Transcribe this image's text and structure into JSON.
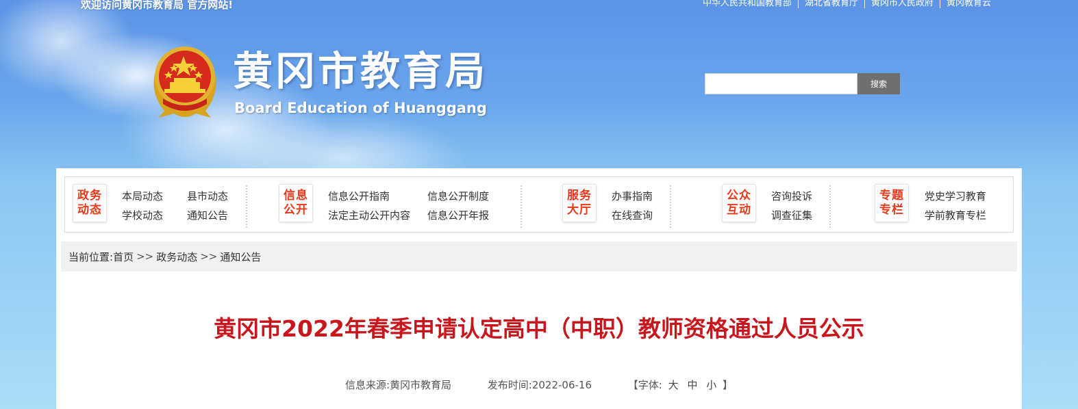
{
  "header": {
    "welcome": "欢迎访问黄冈市教育局 官方网站!",
    "top_links": [
      "中华人民共和国教育部",
      "湖北省教育厅",
      "黄冈市人民政府",
      "黄冈教育云"
    ],
    "site_title": "黄冈市教育局",
    "site_subtitle": "Board Education of Huanggang",
    "search_placeholder": "",
    "search_button": "搜索"
  },
  "nav": {
    "groups": [
      {
        "badge": [
          "政务",
          "动态"
        ],
        "links": [
          "本局动态",
          "县市动态",
          "学校动态",
          "通知公告"
        ]
      },
      {
        "badge": [
          "信息",
          "公开"
        ],
        "links": [
          "信息公开指南",
          "信息公开制度",
          "法定主动公开内容",
          "信息公开年报"
        ]
      },
      {
        "badge": [
          "服务",
          "大厅"
        ],
        "links": [
          "办事指南",
          "在线查询"
        ]
      },
      {
        "badge": [
          "公众",
          "互动"
        ],
        "links": [
          "咨询投诉",
          "调查征集"
        ]
      },
      {
        "badge": [
          "专题",
          "专栏"
        ],
        "links": [
          "党史学习教育",
          "学前教育专栏"
        ]
      }
    ]
  },
  "breadcrumb": {
    "label": "当前位置:",
    "items": [
      "首页",
      "政务动态",
      "通知公告"
    ],
    "separator": ">>"
  },
  "article": {
    "title": "黄冈市2022年春季申请认定高中（中职）教师资格通过人员公示",
    "source": "信息来源:黄冈市教育局",
    "date": "发布时间:2022-06-16",
    "font_open": "【字体:",
    "font_sizes": [
      "大",
      "中",
      "小"
    ],
    "font_close": "】"
  },
  "colors": {
    "title_red": "#c8161d",
    "badge_red": "#e8391a",
    "search_button": "#6f6f6f"
  }
}
